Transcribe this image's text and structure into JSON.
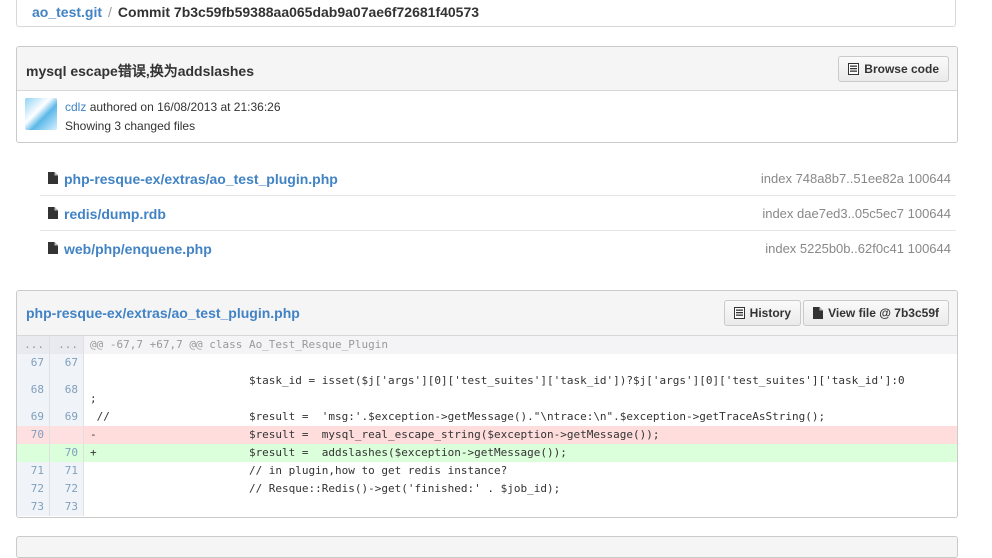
{
  "breadcrumb": {
    "repo": "ao_test.git",
    "separator": "/",
    "current": "Commit 7b3c59fb59388aa065dab9a07ae6f72681f40573"
  },
  "commit": {
    "title": "mysql escape错误,换为addslashes",
    "browse_label": "Browse code",
    "author": "cdlz",
    "authored_text": "authored on 16/08/2013 at 21:36:26",
    "changed_text": "Showing 3 changed files"
  },
  "files": [
    {
      "name": "php-resque-ex/extras/ao_test_plugin.php",
      "index": "index 748a8b7..51ee82a 100644"
    },
    {
      "name": "redis/dump.rdb",
      "index": "index dae7ed3..05c5ec7 100644"
    },
    {
      "name": "web/php/enquene.php",
      "index": "index 5225b0b..62f0c41 100644"
    }
  ],
  "diff": {
    "file": "php-resque-ex/extras/ao_test_plugin.php",
    "history_label": "History",
    "viewfile_label": "View file @ 7b3c59f",
    "lines": [
      {
        "a": "...",
        "b": "...",
        "text": "@@ -67,7 +67,7 @@ class Ao_Test_Resque_Plugin"
      },
      {
        "a": "67",
        "b": "67",
        "text": ""
      },
      {
        "a": "68",
        "b": "68",
        "text": "                        $task_id = isset($j['args'][0]['test_suites']['task_id'])?$j['args'][0]['test_suites']['task_id']:0\n;"
      },
      {
        "a": "69",
        "b": "69",
        "text": " //                     $result =  'msg:'.$exception->getMessage().\"\\ntrace:\\n\".$exception->getTraceAsString();"
      },
      {
        "a": "70",
        "b": "",
        "text": "-                       $result =  mysql_real_escape_string($exception->getMessage());"
      },
      {
        "a": "",
        "b": "70",
        "text": "+                       $result =  addslashes($exception->getMessage());"
      },
      {
        "a": "71",
        "b": "71",
        "text": "                        // in plugin,how to get redis instance?"
      },
      {
        "a": "72",
        "b": "72",
        "text": "                        // Resque::Redis()->get('finished:' . $job_id);"
      },
      {
        "a": "73",
        "b": "73",
        "text": ""
      }
    ]
  }
}
